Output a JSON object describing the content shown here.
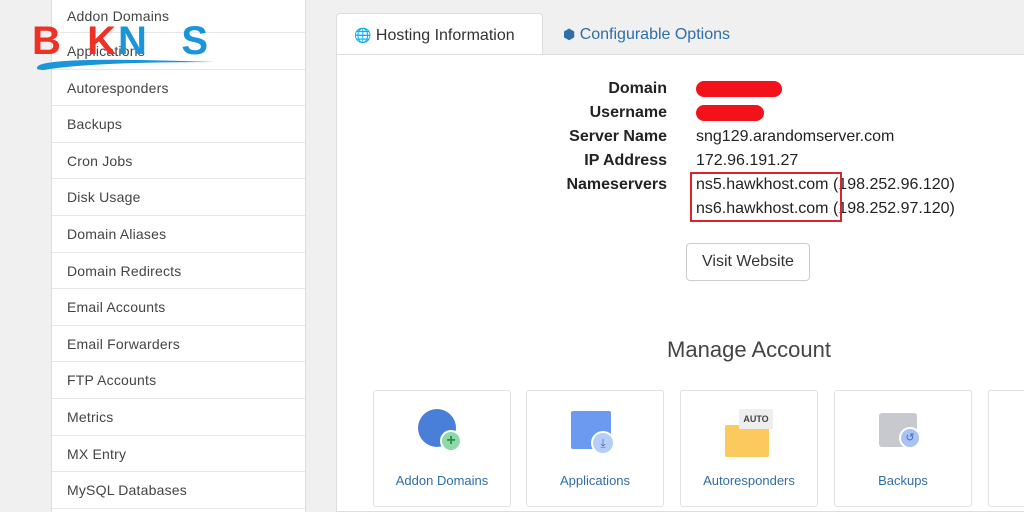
{
  "logo": {
    "text": "BKNS",
    "colors": {
      "bk": "#ee3124",
      "ns": "#1b95d9"
    }
  },
  "sidebar": {
    "items": [
      "Addon Domains",
      "Applications",
      "Autoresponders",
      "Backups",
      "Cron Jobs",
      "Disk Usage",
      "Domain Aliases",
      "Domain Redirects",
      "Email Accounts",
      "Email Forwarders",
      "FTP Accounts",
      "Metrics",
      "MX Entry",
      "MySQL Databases"
    ]
  },
  "tabs": [
    {
      "label": "Hosting Information",
      "icon": "globe-icon",
      "active": true
    },
    {
      "label": "Configurable Options",
      "icon": "cubes-icon",
      "active": false
    }
  ],
  "info": {
    "domain_label": "Domain",
    "domain_value": "",
    "username_label": "Username",
    "username_value": "",
    "server_label": "Server Name",
    "server_value": "sng129.arandomserver.com",
    "ip_label": "IP Address",
    "ip_value": "172.96.191.27",
    "ns_label": "Nameservers",
    "ns1": "ns5.hawkhost.com",
    "ns1_ip": "(198.252.96.120)",
    "ns2": "ns6.hawkhost.com",
    "ns2_ip": "(198.252.97.120)"
  },
  "visit_label": "Visit Website",
  "manage": {
    "title": "Manage Account",
    "tiles": [
      {
        "label": "Addon Domains",
        "icon": "globe-plus-icon"
      },
      {
        "label": "Applications",
        "icon": "app-download-icon"
      },
      {
        "label": "Autoresponders",
        "icon": "auto-envelope-icon",
        "badge": "AUTO"
      },
      {
        "label": "Backups",
        "icon": "drive-backup-icon"
      }
    ]
  }
}
